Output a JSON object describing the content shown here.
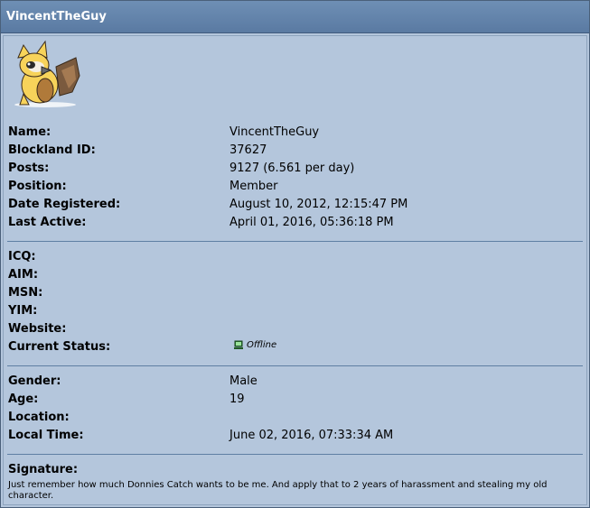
{
  "profile": {
    "username": "VincentTheGuy",
    "details": [
      {
        "label": "Name:",
        "value": "VincentTheGuy"
      },
      {
        "label": "Blockland ID:",
        "value": "37627"
      },
      {
        "label": "Posts:",
        "value": "9127 (6.561 per day)"
      },
      {
        "label": "Position:",
        "value": "Member"
      },
      {
        "label": "Date Registered:",
        "value": "August 10, 2012, 12:15:47 PM"
      },
      {
        "label": "Last Active:",
        "value": "April 01, 2016, 05:36:18 PM"
      }
    ],
    "contact": [
      {
        "label": "ICQ:",
        "value": ""
      },
      {
        "label": "AIM:",
        "value": ""
      },
      {
        "label": "MSN:",
        "value": ""
      },
      {
        "label": "YIM:",
        "value": ""
      },
      {
        "label": "Website:",
        "value": ""
      }
    ],
    "status": {
      "label": "Current Status:",
      "value": "Offline",
      "icon": "offline-computer-icon"
    },
    "personal": [
      {
        "label": "Gender:",
        "value": "Male"
      },
      {
        "label": "Age:",
        "value": "19"
      },
      {
        "label": "Location:",
        "value": ""
      },
      {
        "label": "Local Time:",
        "value": "June 02, 2016, 07:33:34 AM"
      }
    ],
    "signature": {
      "label": "Signature:",
      "text": "Just remember how much Donnies Catch wants to be me. And apply that to 2 years of harassment and stealing my old character."
    }
  },
  "colors": {
    "titlebar": "#5a7aa2",
    "panel": "#b4c6dc",
    "separator": "#5f7fa3"
  }
}
